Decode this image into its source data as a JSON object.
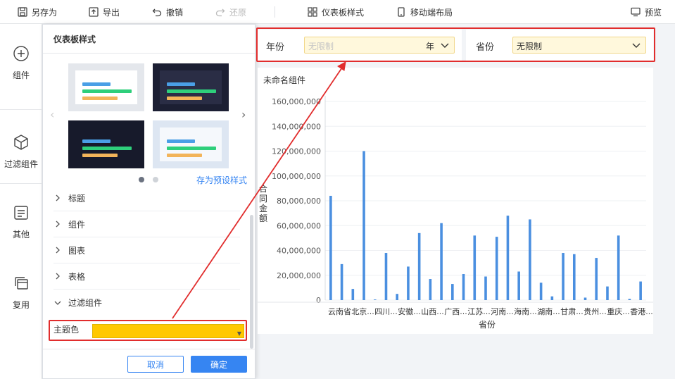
{
  "toolbar": {
    "save_as": "另存为",
    "export": "导出",
    "undo": "撤销",
    "redo": "还原",
    "dashboard_style": "仪表板样式",
    "mobile_layout": "移动端布局",
    "preview": "预览"
  },
  "rail": {
    "items": [
      {
        "label": "组件",
        "icon": "plus-circle-icon"
      },
      {
        "label": "过滤组件",
        "icon": "cube-icon"
      },
      {
        "label": "其他",
        "icon": "text-box-icon"
      },
      {
        "label": "复用",
        "icon": "stack-icon"
      }
    ]
  },
  "panel": {
    "title": "仪表板样式",
    "preset_link": "存为预设样式",
    "sections": [
      "标题",
      "组件",
      "图表",
      "表格",
      "过滤组件"
    ],
    "theme_label": "主题色",
    "theme_color": "#ffc800",
    "cancel": "取消",
    "ok": "确定",
    "thumb_colors": {
      "blue": "#4a9fe6",
      "green": "#2ecf7b",
      "orange": "#f2b45a"
    }
  },
  "filters": {
    "year_label": "年份",
    "year_placeholder": "无限制",
    "year_unit": "年",
    "province_label": "省份",
    "province_value": "无限制"
  },
  "highlight_color": "#e12d2d",
  "chart_widget": {
    "title": "未命名组件",
    "bar_color": "#4a8fe0"
  },
  "chart_data": {
    "type": "bar",
    "ylabel": "合同金额",
    "xlabel": "省份",
    "ylim": [
      0,
      160000000
    ],
    "yticks": [
      "0",
      "20,000,000",
      "40,000,000",
      "60,000,000",
      "80,000,000",
      "100,000,000",
      "120,000,000",
      "140,000,000",
      "160,000,000"
    ],
    "category_labels": [
      "云南省",
      "北京...",
      "四川...",
      "安徽...",
      "山西...",
      "广西...",
      "江苏...",
      "河南...",
      "海南...",
      "湖南...",
      "甘肃...",
      "贵州...",
      "重庆...",
      "香港..."
    ],
    "values": [
      84000000,
      29000000,
      9000000,
      120000000,
      500000,
      38000000,
      5000000,
      27000000,
      54000000,
      17000000,
      62000000,
      13000000,
      21000000,
      52000000,
      19000000,
      51000000,
      68000000,
      23000000,
      65000000,
      14000000,
      3000000,
      38000000,
      37000000,
      2000000,
      34000000,
      11000000,
      52000000,
      1000000,
      15000000
    ]
  }
}
